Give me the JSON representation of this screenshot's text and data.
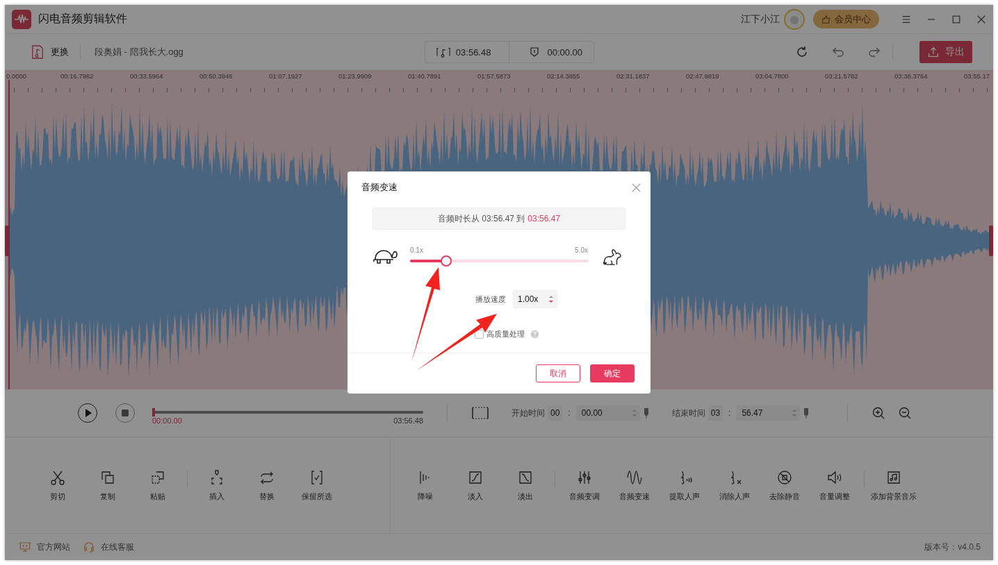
{
  "window": {
    "title": "闪电音频剪辑软件",
    "user_name": "江下小江",
    "vip_button": "会员中心"
  },
  "toolbar": {
    "replace_label": "更换",
    "file_name": "段奥娟 - 陪我长大.ogg",
    "duration": "03:56.48",
    "selection_duration": "00:00.00",
    "export_button": "导出"
  },
  "timeline": {
    "ticks": [
      "0.0000",
      "00:16.7982",
      "00:33.5964",
      "00:50.3946",
      "01:07.1927",
      "01:23.9909",
      "01:40.7891",
      "01:57.5873",
      "02:14.3855",
      "02:31.1837",
      "02:47.9819",
      "03:04.7800",
      "03:21.5782",
      "03:38.3764",
      "03:55.17"
    ]
  },
  "player": {
    "progress": {
      "level": 0,
      "current": "00:00.00",
      "total": "03:56.48"
    },
    "start": {
      "label": "开始时间",
      "minutes": "00",
      "separator": ":",
      "seconds": "00.00"
    },
    "end": {
      "label": "结束时间",
      "minutes": "03",
      "separator": ":",
      "seconds": "56.47"
    }
  },
  "tools": [
    {
      "groups": [
        [
          {
            "kind": "cut",
            "label": "剪切"
          },
          {
            "kind": "copy",
            "label": "复制"
          },
          {
            "kind": "paste",
            "label": "粘贴"
          }
        ],
        [
          {
            "kind": "insert",
            "label": "插入"
          },
          {
            "kind": "replace",
            "label": "替换"
          },
          {
            "kind": "keep",
            "label": "保留所选"
          }
        ]
      ]
    },
    {
      "groups": [
        [
          {
            "kind": "denoise",
            "label": "降噪"
          },
          {
            "kind": "fadein",
            "label": "淡入"
          },
          {
            "kind": "fadeout",
            "label": "淡出"
          }
        ],
        [
          {
            "kind": "pitch",
            "label": "音频变调"
          },
          {
            "kind": "speed",
            "label": "音频变速"
          },
          {
            "kind": "extract",
            "label": "提取人声"
          },
          {
            "kind": "remove",
            "label": "消除人声"
          },
          {
            "kind": "silence",
            "label": "去除静音"
          },
          {
            "kind": "volume",
            "label": "音量调整"
          }
        ],
        [
          {
            "kind": "bgm",
            "label": "添加背景音乐"
          }
        ]
      ]
    }
  ],
  "footer": {
    "links": [
      {
        "kind": "website",
        "label": "官方网站"
      },
      {
        "kind": "service",
        "label": "在线客服"
      }
    ],
    "version": "版本号：v4.0.5"
  },
  "dialog": {
    "title": "音频变速",
    "duration_text": "音频时长从 03:56.47 到",
    "new_duration": "03:56.47",
    "slider": {
      "min_label": "0.1x",
      "max_label": "5.0x",
      "level": 0.2
    },
    "speed_label": "播放速度",
    "speed_value": "1.00x",
    "high_quality": {
      "label": "高质量处理",
      "checked": false
    },
    "cancel_button": "取消",
    "ok_button": "确定"
  }
}
